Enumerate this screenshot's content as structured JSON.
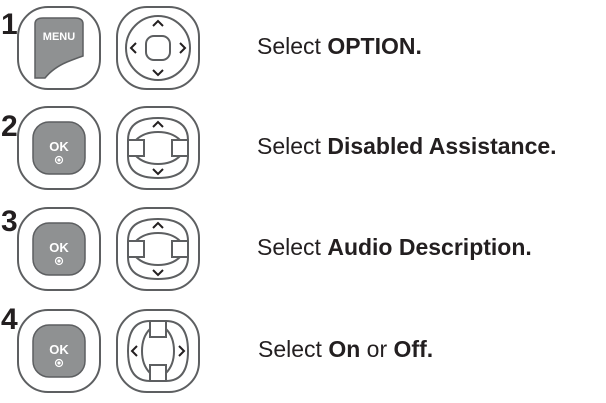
{
  "steps": [
    {
      "number": "1",
      "button_label": "MENU",
      "nav_type": "four-way",
      "text": {
        "prefix": "Select ",
        "bold": "OPTION.",
        "middle": "",
        "bold2": "",
        "suffix": ""
      }
    },
    {
      "number": "2",
      "button_label": "OK",
      "nav_type": "up-down",
      "text": {
        "prefix": "Select ",
        "bold": "Disabled Assistance.",
        "middle": "",
        "bold2": "",
        "suffix": ""
      }
    },
    {
      "number": "3",
      "button_label": "OK",
      "nav_type": "up-down",
      "text": {
        "prefix": "Select ",
        "bold": "Audio Description.",
        "middle": "",
        "bold2": "",
        "suffix": ""
      }
    },
    {
      "number": "4",
      "button_label": "OK",
      "nav_type": "left-right",
      "text": {
        "prefix": "Select ",
        "bold": "On",
        "middle": " or ",
        "bold2": "Off.",
        "suffix": ""
      }
    }
  ],
  "colors": {
    "button_fill": "#8f9192",
    "button_ring": "#5d5f61",
    "text": "#231f20",
    "background": "#ffffff"
  },
  "icons": [
    "menu-button-icon",
    "ok-button-icon",
    "four-way-nav-icon",
    "up-down-nav-icon",
    "left-right-nav-icon"
  ]
}
